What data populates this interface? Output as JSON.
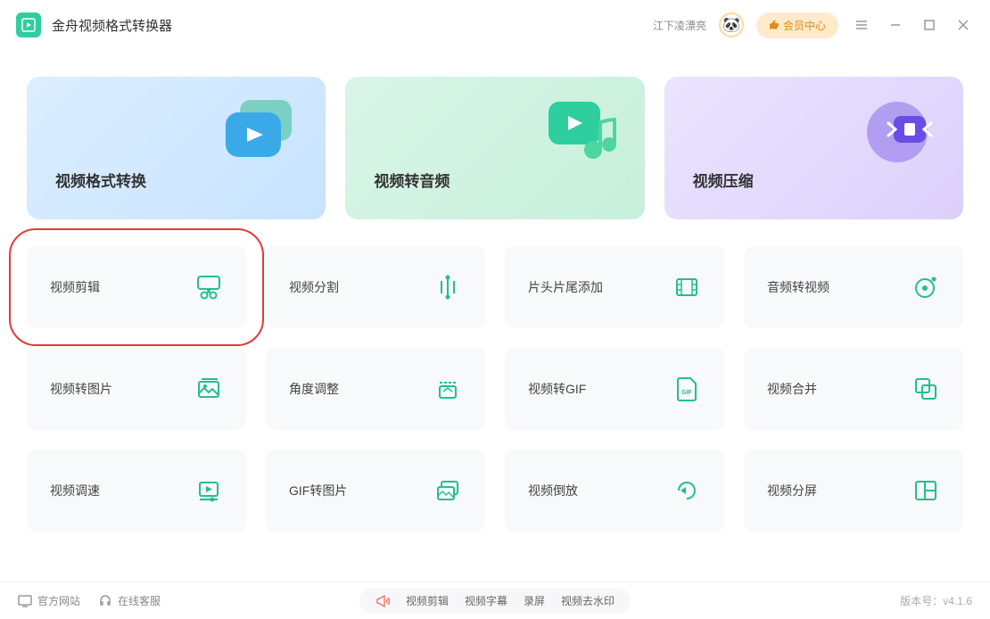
{
  "app": {
    "title": "金舟视频格式转换器"
  },
  "user": {
    "name": "江下凌漂亮",
    "vip": "会员中心"
  },
  "hero": [
    {
      "label": "视频格式转换"
    },
    {
      "label": "视频转音频"
    },
    {
      "label": "视频压缩"
    }
  ],
  "tools": [
    {
      "label": "视频剪辑",
      "highlight": true
    },
    {
      "label": "视频分割"
    },
    {
      "label": "片头片尾添加"
    },
    {
      "label": "音频转视频"
    },
    {
      "label": "视频转图片"
    },
    {
      "label": "角度调整"
    },
    {
      "label": "视频转GIF"
    },
    {
      "label": "视频合并"
    },
    {
      "label": "视频调速"
    },
    {
      "label": "GIF转图片"
    },
    {
      "label": "视频倒放"
    },
    {
      "label": "视频分屏"
    }
  ],
  "footer": {
    "site": "官方网站",
    "service": "在线客服",
    "center": [
      "视频剪辑",
      "视频字幕",
      "录屏",
      "视频去水印"
    ],
    "version_prefix": "版本号：",
    "version": "v4.1.6"
  }
}
